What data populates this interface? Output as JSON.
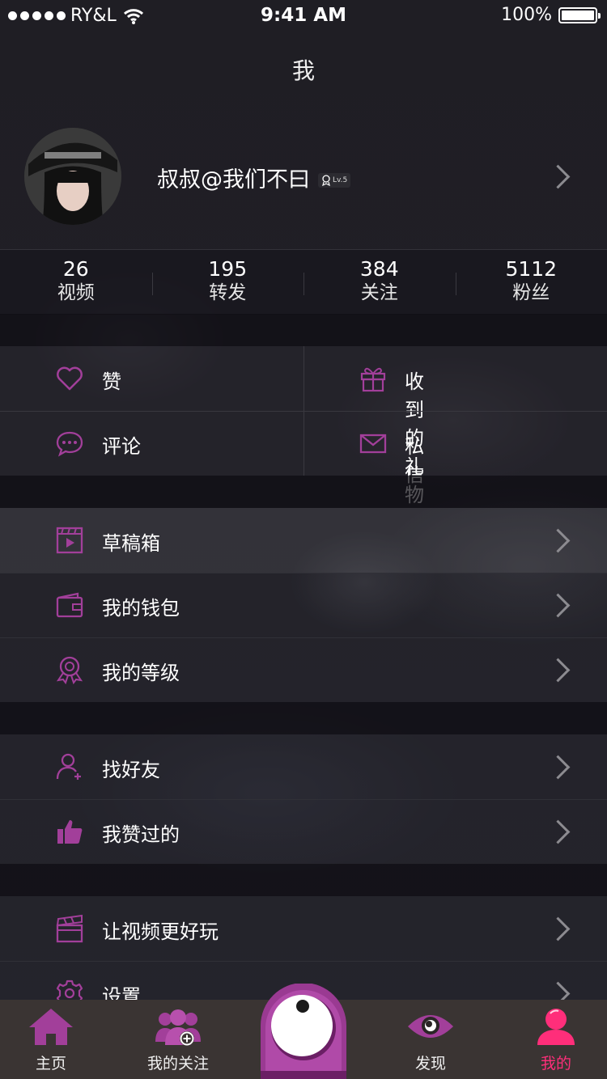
{
  "status_bar": {
    "carrier": "RY&L",
    "time": "9:41 AM",
    "battery": "100%"
  },
  "nav": {
    "title": "我"
  },
  "profile": {
    "username": "叔叔@我们不曰",
    "level": "Lv.5"
  },
  "stats": [
    {
      "value": "26",
      "label": "视频"
    },
    {
      "value": "195",
      "label": "转发"
    },
    {
      "value": "384",
      "label": "关注"
    },
    {
      "value": "5112",
      "label": "粉丝"
    }
  ],
  "grid": {
    "likes": "赞",
    "gifts": "收到的礼物",
    "comments": "评论",
    "messages": "私信"
  },
  "menu": {
    "drafts": "草稿箱",
    "wallet": "我的钱包",
    "level": "我的等级",
    "find_friends": "找好友",
    "liked": "我赞过的",
    "video_fun": "让视频更好玩",
    "settings": "设置"
  },
  "tabbar": {
    "home": "主页",
    "following": "我的关注",
    "discover": "发现",
    "me": "我的"
  },
  "colors": {
    "accent": "#a23f9a",
    "active_tab": "#ff2e7a",
    "tabbar_bg": "#3a3433"
  },
  "icons": {
    "heart": "heart-icon",
    "gift": "gift-icon",
    "comment": "comment-icon",
    "mail": "mail-icon",
    "drafts": "film-icon",
    "wallet": "wallet-icon",
    "level": "medal-icon",
    "find_friends": "add-user-icon",
    "liked": "thumbs-up-icon",
    "video_fun": "clapperboard-icon",
    "settings": "gear-icon"
  }
}
